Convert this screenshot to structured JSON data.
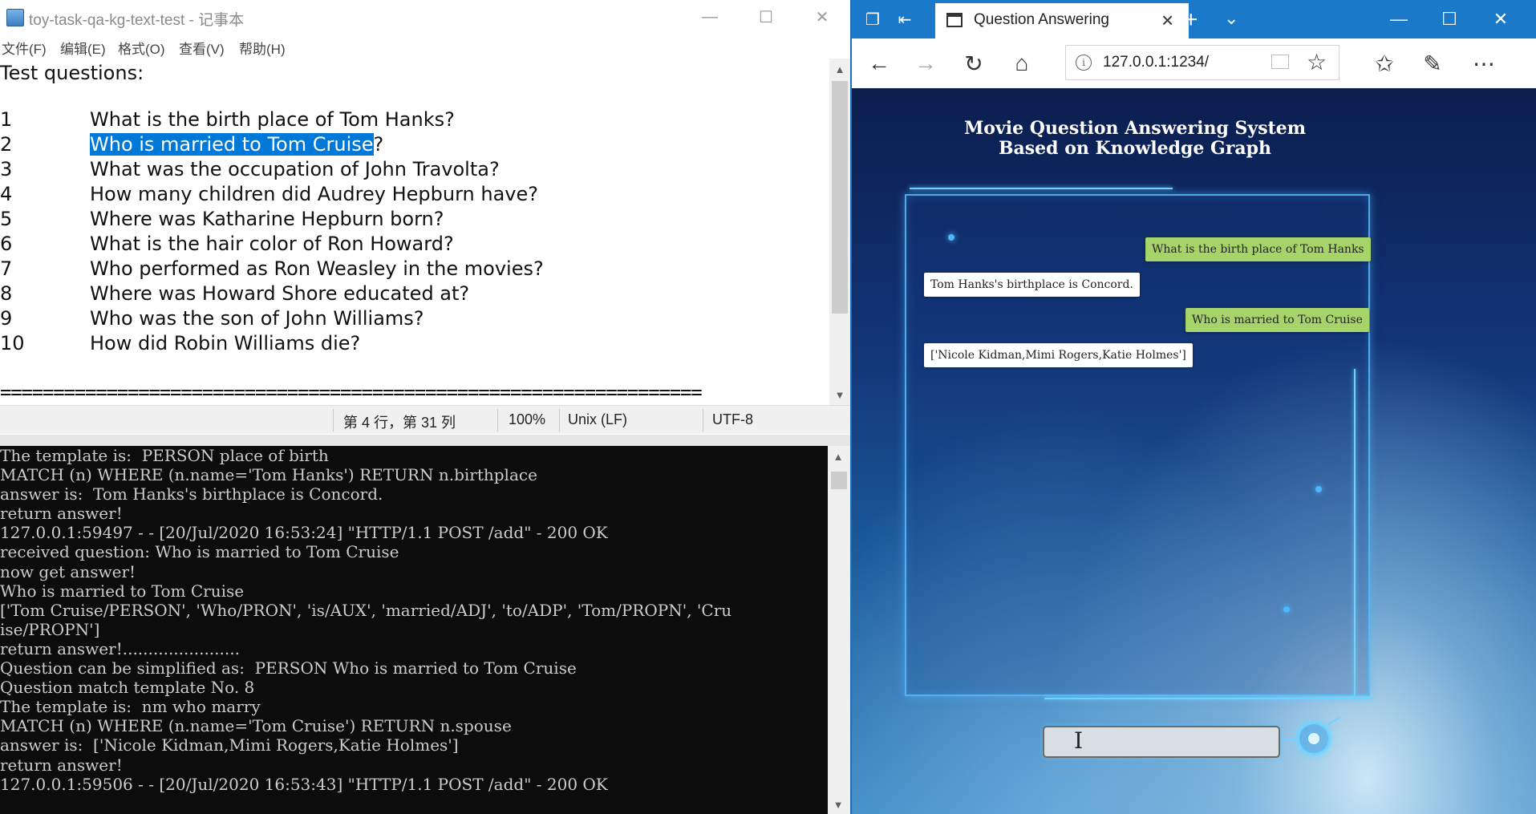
{
  "notepad": {
    "title": "toy-task-qa-kg-text-test - 记事本",
    "window_controls": {
      "minimize": "—",
      "maximize": "☐",
      "close": "✕"
    },
    "menu": [
      "文件(F)",
      "编辑(E)",
      "格式(O)",
      "查看(V)",
      "帮助(H)"
    ],
    "heading": "Test questions:",
    "questions": [
      {
        "num": "1",
        "text": "What is the birth place of Tom Hanks?"
      },
      {
        "num": "2",
        "selected": "Who is married to Tom Cruise",
        "rest": "?"
      },
      {
        "num": "3",
        "text": "What was the occupation of John Travolta?"
      },
      {
        "num": "4",
        "text": "How many children did Audrey Hepburn have?"
      },
      {
        "num": "5",
        "text": "Where was Katharine Hepburn born?"
      },
      {
        "num": "6",
        "text": "What is the hair color of Ron Howard?"
      },
      {
        "num": "7",
        "text": "Who performed as Ron Weasley in the movies?"
      },
      {
        "num": "8",
        "text": "Where was Howard Shore educated at?"
      },
      {
        "num": "9",
        "text": "Who was the son of John Williams?"
      },
      {
        "num": "10",
        "text": "How did Robin Williams die?"
      }
    ],
    "separator": "==================================================================",
    "status": {
      "position": "第 4 行，第 31 列",
      "zoom": "100%",
      "line_ending": "Unix (LF)",
      "encoding": "UTF-8"
    }
  },
  "console": {
    "lines": [
      "The template is:  PERSON place of birth",
      "MATCH (n) WHERE (n.name='Tom Hanks') RETURN n.birthplace",
      "answer is:  Tom Hanks's birthplace is Concord.",
      "return answer!",
      "127.0.0.1:59497 - - [20/Jul/2020 16:53:24] \"HTTP/1.1 POST /add\" - 200 OK",
      "received question: Who is married to Tom Cruise",
      "now get answer!",
      "Who is married to Tom Cruise",
      "['Tom Cruise/PERSON', 'Who/PRON', 'is/AUX', 'married/ADJ', 'to/ADP', 'Tom/PROPN', 'Cru",
      "ise/PROPN']",
      "return answer!.......................",
      "Question can be simplified as:  PERSON Who is married to Tom Cruise",
      "Question match template No. 8",
      "The template is:  nm who marry",
      "MATCH (n) WHERE (n.name='Tom Cruise') RETURN n.spouse",
      "answer is:  ['Nicole Kidman,Mimi Rogers,Katie Holmes']",
      "return answer!",
      "127.0.0.1:59506 - - [20/Jul/2020 16:53:43] \"HTTP/1.1 POST /add\" - 200 OK"
    ]
  },
  "browser": {
    "tab_title": "Question Answering",
    "url": "127.0.0.1:1234/",
    "page": {
      "title_line1": "Movie Question Answering System",
      "title_line2": "Based on Knowledge Graph",
      "messages": [
        {
          "role": "user",
          "text": "What is the birth place of Tom Hanks"
        },
        {
          "role": "bot",
          "text": "Tom Hanks's birthplace is Concord."
        },
        {
          "role": "user",
          "text": "Who is married to Tom Cruise"
        },
        {
          "role": "bot",
          "text": "['Nicole Kidman,Mimi Rogers,Katie Holmes']"
        }
      ],
      "input_value": ""
    }
  },
  "colors": {
    "selection": "#0078d7",
    "edge_accent": "#1b79c9",
    "user_bubble": "#a7d36b",
    "bot_bubble": "#ffffff",
    "console_bg": "#0c0c0c"
  }
}
